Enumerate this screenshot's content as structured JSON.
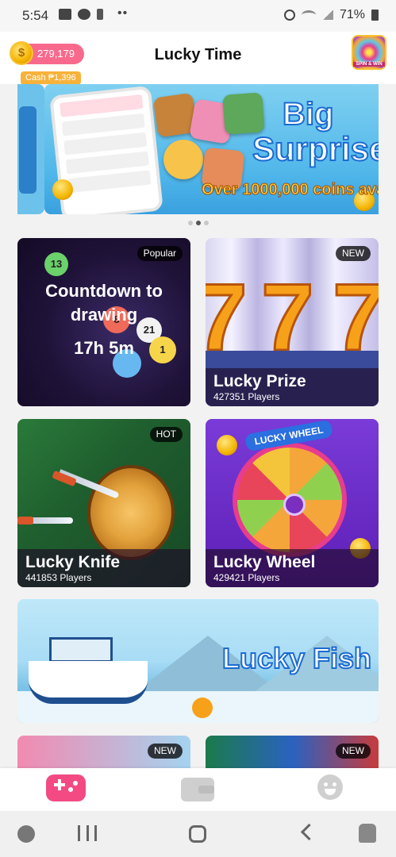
{
  "status_bar": {
    "time": "5:54",
    "battery": "71%",
    "more": "••"
  },
  "header": {
    "title": "Lucky Time",
    "coins": "279,179",
    "cash": "Cash ₱1,396",
    "spin_label": "SPIN & WIN"
  },
  "banner": {
    "line1": "Big",
    "line2": "Surprise",
    "line3": "Over 1000,000 coins availa",
    "pages": 3,
    "active_page": 2
  },
  "games": [
    {
      "id": "countdown",
      "tag": "Popular",
      "headline": "Countdown to drawing",
      "timer": "17h 5m"
    },
    {
      "id": "prize",
      "tag": "NEW",
      "name": "Lucky Prize",
      "players": "427351 Players"
    },
    {
      "id": "knife",
      "tag": "HOT",
      "name": "Lucky Knife",
      "players": "441853 Players"
    },
    {
      "id": "wheel",
      "tag": "",
      "name": "Lucky Wheel",
      "players": "429421 Players",
      "wheel_label": "LUCKY WHEEL"
    },
    {
      "id": "fish",
      "tag": "",
      "name": "Lucky Fish"
    },
    {
      "id": "next1",
      "tag": "NEW"
    },
    {
      "id": "next2",
      "tag": "NEW"
    }
  ],
  "bottom_nav": {
    "items": [
      {
        "icon": "gamepad-icon",
        "active": true
      },
      {
        "icon": "wallet-icon",
        "active": false
      },
      {
        "icon": "face-icon",
        "active": false
      }
    ]
  },
  "colors": {
    "accent": "#f34a84",
    "coin_pill": "#f86a8c",
    "cash_tag": "#f7b23b"
  }
}
